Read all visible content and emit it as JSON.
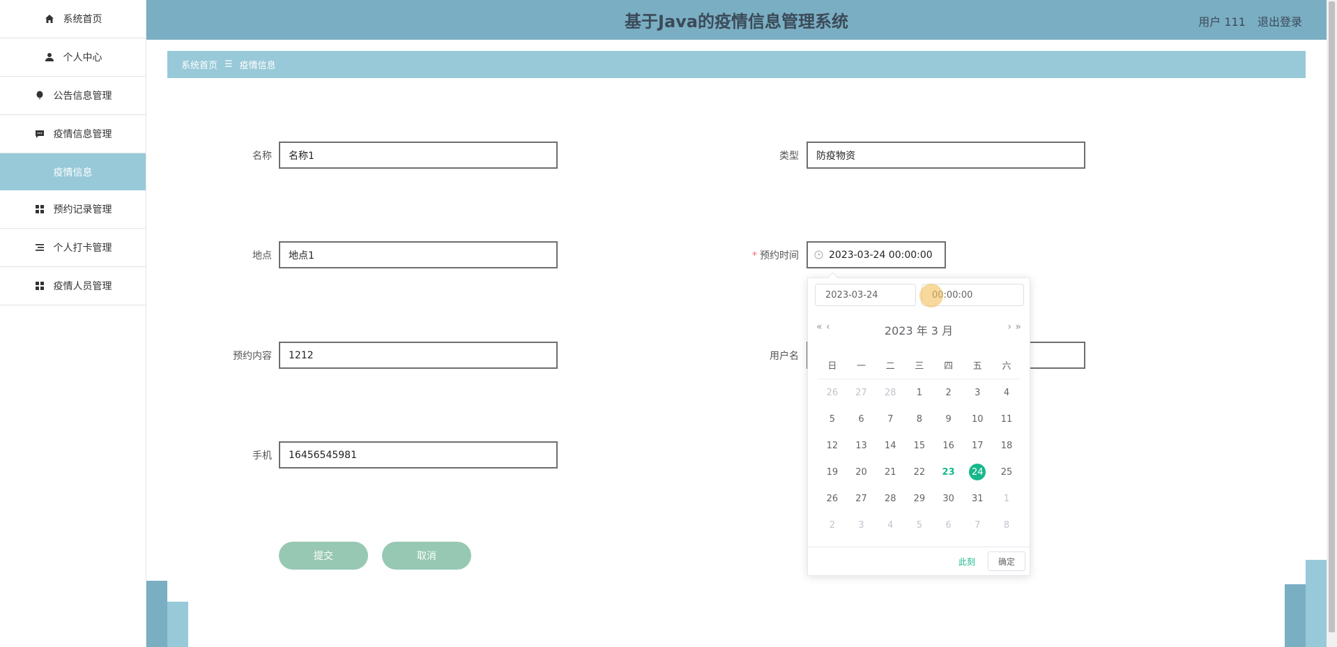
{
  "sidebar": {
    "items": [
      {
        "label": "系统首页",
        "icon": "home-icon"
      },
      {
        "label": "个人中心",
        "icon": "person-icon"
      },
      {
        "label": "公告信息管理",
        "icon": "balloon-icon"
      },
      {
        "label": "疫情信息管理",
        "icon": "chat-icon"
      },
      {
        "label": "疫情信息",
        "icon": ""
      },
      {
        "label": "预约记录管理",
        "icon": "grid-icon"
      },
      {
        "label": "个人打卡管理",
        "icon": "list-icon"
      },
      {
        "label": "疫情人员管理",
        "icon": "grid-icon"
      }
    ]
  },
  "header": {
    "title": "基于Java的疫情信息管理系统",
    "user": "用户 111",
    "logout": "退出登录"
  },
  "breadcrumb": {
    "home": "系统首页",
    "sep": "☰",
    "current": "疫情信息"
  },
  "form": {
    "name_label": "名称",
    "name_value": "名称1",
    "type_label": "类型",
    "type_value": "防疫物资",
    "place_label": "地点",
    "place_value": "地点1",
    "time_label": "预约时间",
    "time_required": "*",
    "time_value": "2023-03-24 00:00:00",
    "content_label": "预约内容",
    "content_value": "1212",
    "username_label": "用户名",
    "phone_label": "手机",
    "phone_value": "16456545981",
    "submit": "提交",
    "cancel": "取消"
  },
  "picker": {
    "date_value": "2023-03-24",
    "time_value": "00:00:00",
    "year_month": "2023 年  3 月",
    "prev_year": "«",
    "prev_month": "‹",
    "next_month": "›",
    "next_year": "»",
    "weekdays": [
      "日",
      "一",
      "二",
      "三",
      "四",
      "五",
      "六"
    ],
    "weeks": [
      [
        "26",
        "27",
        "28",
        "1",
        "2",
        "3",
        "4"
      ],
      [
        "5",
        "6",
        "7",
        "8",
        "9",
        "10",
        "11"
      ],
      [
        "12",
        "13",
        "14",
        "15",
        "16",
        "17",
        "18"
      ],
      [
        "19",
        "20",
        "21",
        "22",
        "23",
        "24",
        "25"
      ],
      [
        "26",
        "27",
        "28",
        "29",
        "30",
        "31",
        "1"
      ],
      [
        "2",
        "3",
        "4",
        "5",
        "6",
        "7",
        "8"
      ]
    ],
    "now": "此刻",
    "ok": "确定"
  },
  "colors": {
    "header": "#7aaec3",
    "breadcrumb": "#98c9d8",
    "accent": "#19b88c",
    "button": "#97c8b3"
  }
}
